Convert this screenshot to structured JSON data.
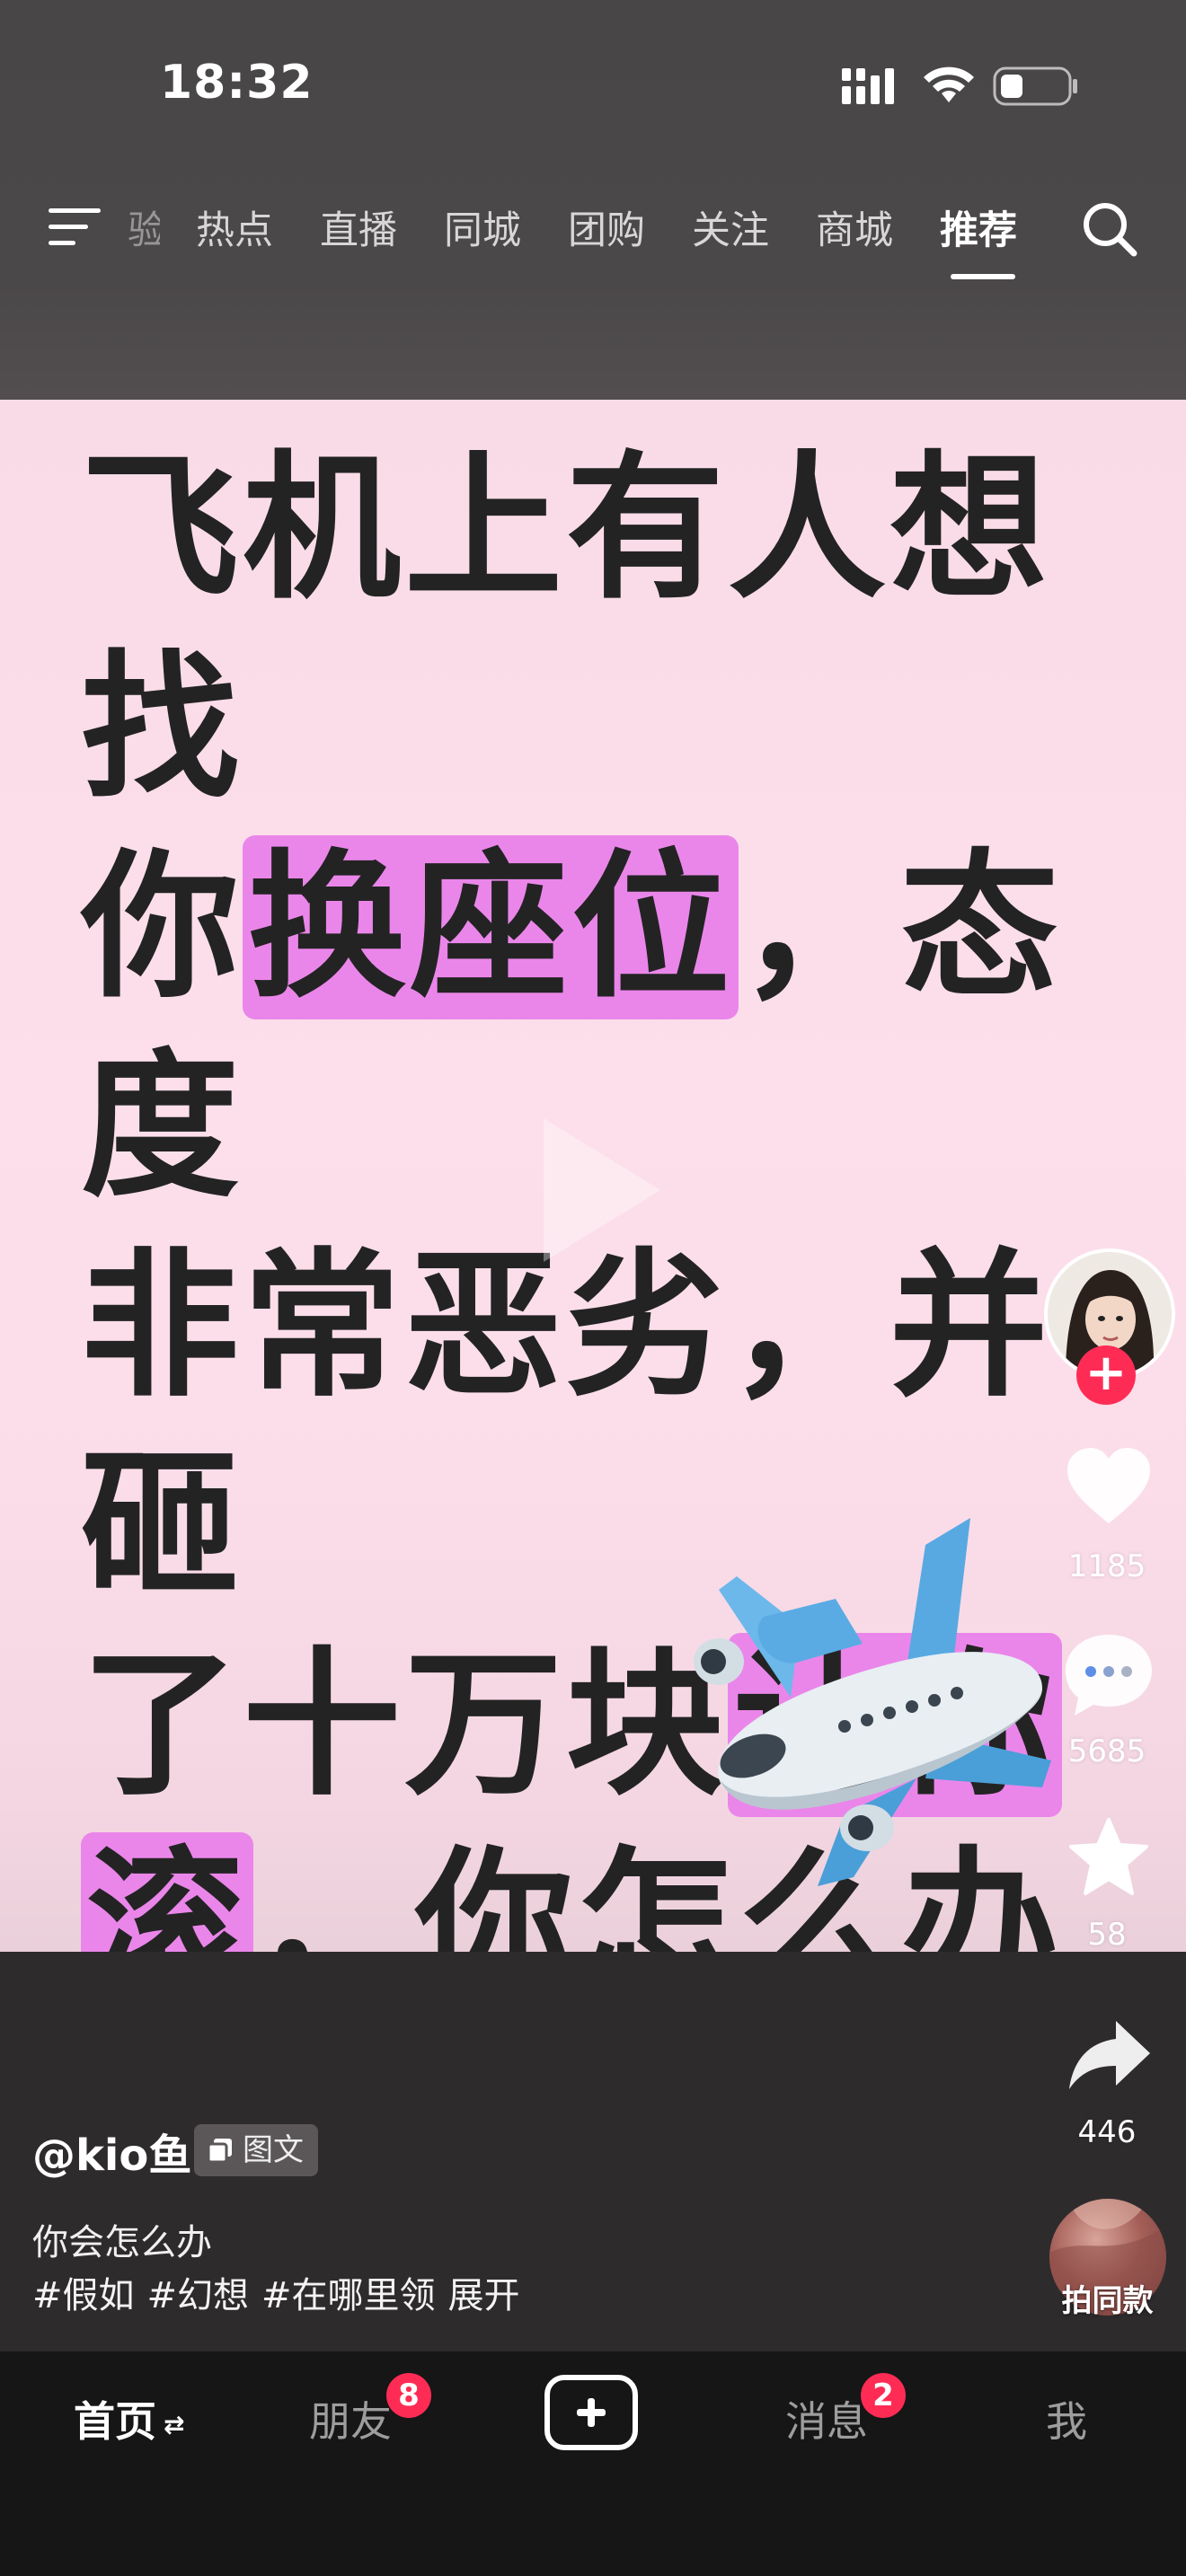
{
  "status_bar": {
    "time": "18:32"
  },
  "nav": {
    "partial_tab": "验",
    "tabs": [
      "热点",
      "直播",
      "同城",
      "团购",
      "关注",
      "商城",
      "推荐"
    ],
    "active_tab": "推荐"
  },
  "post": {
    "headline_lines": [
      [
        "飞机上有人想找"
      ],
      [
        "你",
        "换座位",
        "，态度"
      ],
      [
        "非常恶劣，并砸"
      ],
      [
        "了十万块",
        "让你"
      ],
      [
        "滚",
        "，你怎么办"
      ]
    ],
    "highlight_color": "#ea86ea"
  },
  "actions": {
    "likes": "1185",
    "comments": "5685",
    "favorites": "58",
    "shares": "446"
  },
  "info": {
    "author": "@kio鱼",
    "type_badge": "图文",
    "caption": "你会怎么办",
    "hashtags": [
      "#假如",
      "#幻想",
      "#在哪里领"
    ],
    "expand": "展开",
    "same_style": "拍同款"
  },
  "bottom_nav": {
    "home": "首页",
    "friends": "朋友",
    "friends_badge": "8",
    "messages": "消息",
    "messages_badge": "2",
    "me": "我"
  },
  "colors": {
    "accent_red": "#fe2c55",
    "card_bg": "#fbdde9"
  }
}
